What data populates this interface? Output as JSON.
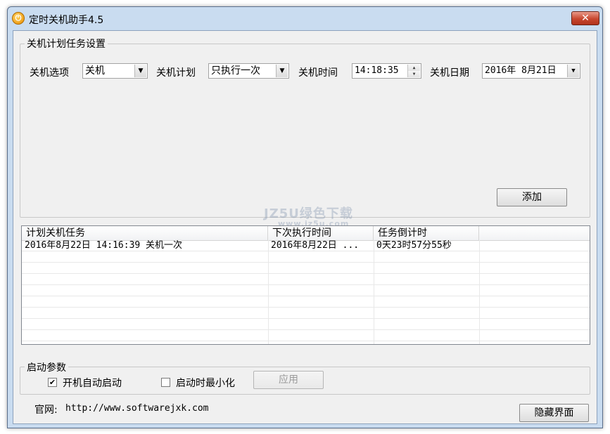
{
  "window": {
    "title": "定时关机助手4.5",
    "close_label": "✕"
  },
  "task_settings": {
    "group_title": "关机计划任务设置",
    "shutdown_option_label": "关机选项",
    "shutdown_option_value": "关机",
    "plan_label": "关机计划",
    "plan_value": "只执行一次",
    "time_label": "关机时间",
    "time_value": "14:18:35",
    "date_label": "关机日期",
    "date_value": "2016年 8月21日",
    "add_button": "添加"
  },
  "task_list": {
    "columns": [
      "计划关机任务",
      "下次执行时间",
      "任务倒计时"
    ],
    "rows": [
      [
        "2016年8月22日 14:16:39 关机一次",
        "2016年8月22日 ...",
        "0天23时57分55秒"
      ]
    ]
  },
  "startup": {
    "group_title": "启动参数",
    "autostart_label": "开机自动启动",
    "autostart_checked": true,
    "minimize_label": "启动时最小化",
    "minimize_checked": false,
    "apply_button": "应用"
  },
  "footer": {
    "website_label": "官网:",
    "website_url": "http://www.softwarejxk.com",
    "hide_button": "隐藏界面"
  },
  "watermark": {
    "line1": "JZ5U绿色下载",
    "line2": "www.jz5u.com"
  },
  "colors": {
    "title_bar": "#c9dcf0",
    "close_button": "#c8472f",
    "client_bg": "#f0f0f0"
  }
}
